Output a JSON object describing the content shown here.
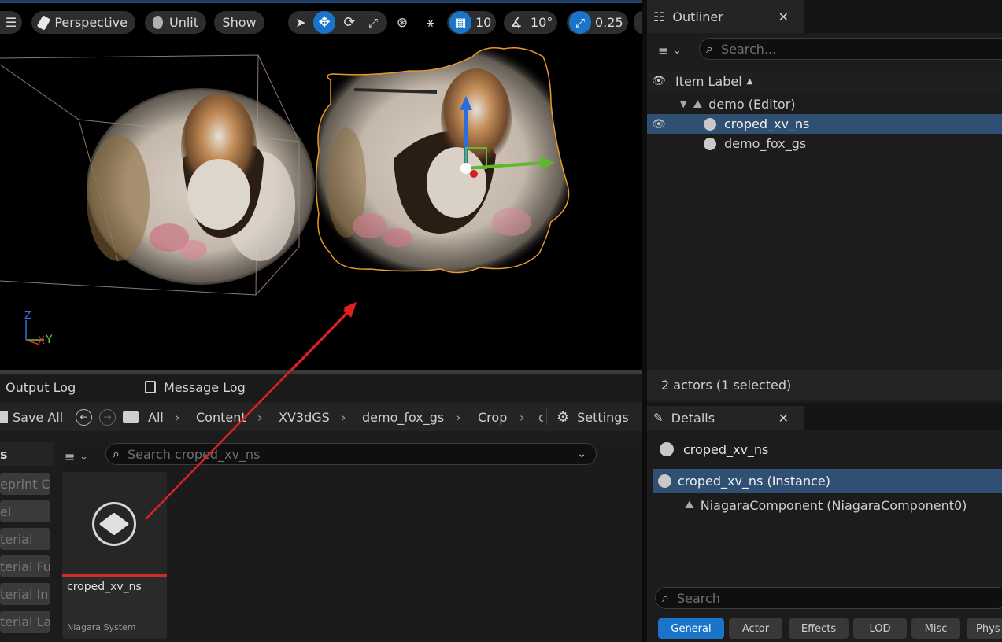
{
  "viewport": {
    "view_mode": "Perspective",
    "lighting": "Unlit",
    "show_label": "Show",
    "grid_snap_value": "10",
    "rotation_snap_value": "10°",
    "scale_snap_value": "0.25",
    "axis_labels": {
      "z": "Z",
      "x": "X",
      "y": "Y"
    }
  },
  "bottom_tabs": {
    "output_log": "Output Log",
    "message_log": "Message Log"
  },
  "content_browser": {
    "save_all": "Save All",
    "breadcrumbs": [
      "All",
      "Content",
      "XV3dGS",
      "demo_fox_gs",
      "Crop"
    ],
    "settings": "Settings",
    "filters_header": "s",
    "filter_items": [
      "eprint C",
      "el",
      "terial",
      "terial Fu",
      "terial In:",
      "terial La"
    ],
    "search_placeholder": "Search croped_xv_ns",
    "asset": {
      "name": "croped_xv_ns",
      "type": "Niagara System"
    }
  },
  "outliner": {
    "title": "Outliner",
    "search_placeholder": "Search...",
    "column_header": "Item Label",
    "tree": {
      "root": "demo (Editor)",
      "items": [
        "croped_xv_ns",
        "demo_fox_gs"
      ]
    },
    "status": "2 actors (1 selected)"
  },
  "details": {
    "title": "Details",
    "actor_name": "croped_xv_ns",
    "components": {
      "instance": "croped_xv_ns (Instance)",
      "child": "NiagaraComponent (NiagaraComponent0)"
    },
    "search_placeholder": "Search",
    "filter_tabs": [
      "General",
      "Actor",
      "Effects",
      "LOD",
      "Misc",
      "Phys"
    ]
  },
  "colors": {
    "accent_blue": "#1a74c9",
    "selection_orange": "#e89a2c",
    "arrow_red": "#e02020",
    "selected_row": "#2f4f73"
  }
}
